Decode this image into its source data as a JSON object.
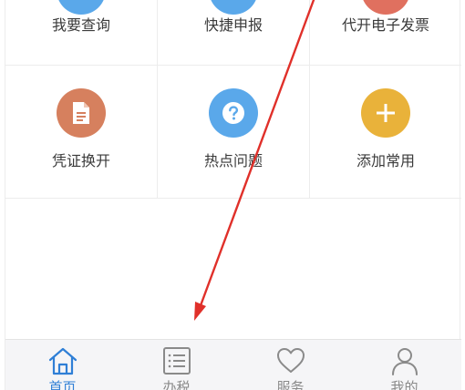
{
  "grid": {
    "items": [
      {
        "label": "我要查询",
        "icon": "search-icon",
        "color": "#5aa8ea"
      },
      {
        "label": "快捷申报",
        "icon": "declare-icon",
        "color": "#5aa8ea"
      },
      {
        "label": "代开电子发票",
        "icon": "invoice-icon",
        "color": "#e0705f"
      },
      {
        "label": "凭证换开",
        "icon": "document-icon",
        "color": "#d6805e"
      },
      {
        "label": "热点问题",
        "icon": "question-icon",
        "color": "#5aa8ea"
      },
      {
        "label": "添加常用",
        "icon": "plus-icon",
        "color": "#e9b23a"
      }
    ]
  },
  "tabbar": {
    "items": [
      {
        "label": "首页",
        "icon": "home-icon",
        "active": true
      },
      {
        "label": "办税",
        "icon": "list-icon",
        "active": false
      },
      {
        "label": "服务",
        "icon": "heart-icon",
        "active": false
      },
      {
        "label": "我的",
        "icon": "user-icon",
        "active": false
      }
    ],
    "active_color": "#2f7fd6",
    "inactive_color": "#8a8a8a"
  },
  "annotation": {
    "icon": "red-arrow-icon",
    "color": "#e0302a"
  }
}
